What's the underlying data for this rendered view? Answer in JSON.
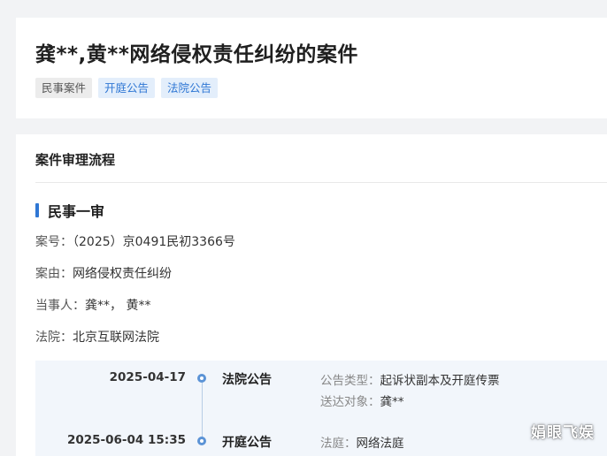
{
  "header": {
    "title": "龚**,黄**网络侵权责任纠纷的案件",
    "tags": [
      "民事案件",
      "开庭公告",
      "法院公告"
    ]
  },
  "process": {
    "section_title": "案件审理流程",
    "stage_title": "民事一审",
    "case_number_label": "案号：",
    "case_number": "（2025）京0491民初3366号",
    "cause_label": "案由：",
    "cause": "网络侵权责任纠纷",
    "parties_label": "当事人：",
    "parties": "龚**，  黄**",
    "court_label": "法院：",
    "court": "北京互联网法院"
  },
  "timeline": [
    {
      "date": "2025-04-17",
      "type": "法院公告",
      "detail1_label": "公告类型：",
      "detail1_value": "起诉状副本及开庭传票",
      "detail2_label": "送达对象：",
      "detail2_value": "龚**"
    },
    {
      "date": "2025-06-04 15:35",
      "type": "开庭公告",
      "detail1_label": "法庭：",
      "detail1_value": "网络法庭"
    }
  ],
  "watermark": "娟眼飞娱",
  "colors": {
    "accent": "#2f77d4",
    "tag_blue_bg": "#e3eefb",
    "tag_gray_bg": "#ececec",
    "timeline_bg": "#f2f6fb",
    "page_bg": "#f2f3f5"
  }
}
